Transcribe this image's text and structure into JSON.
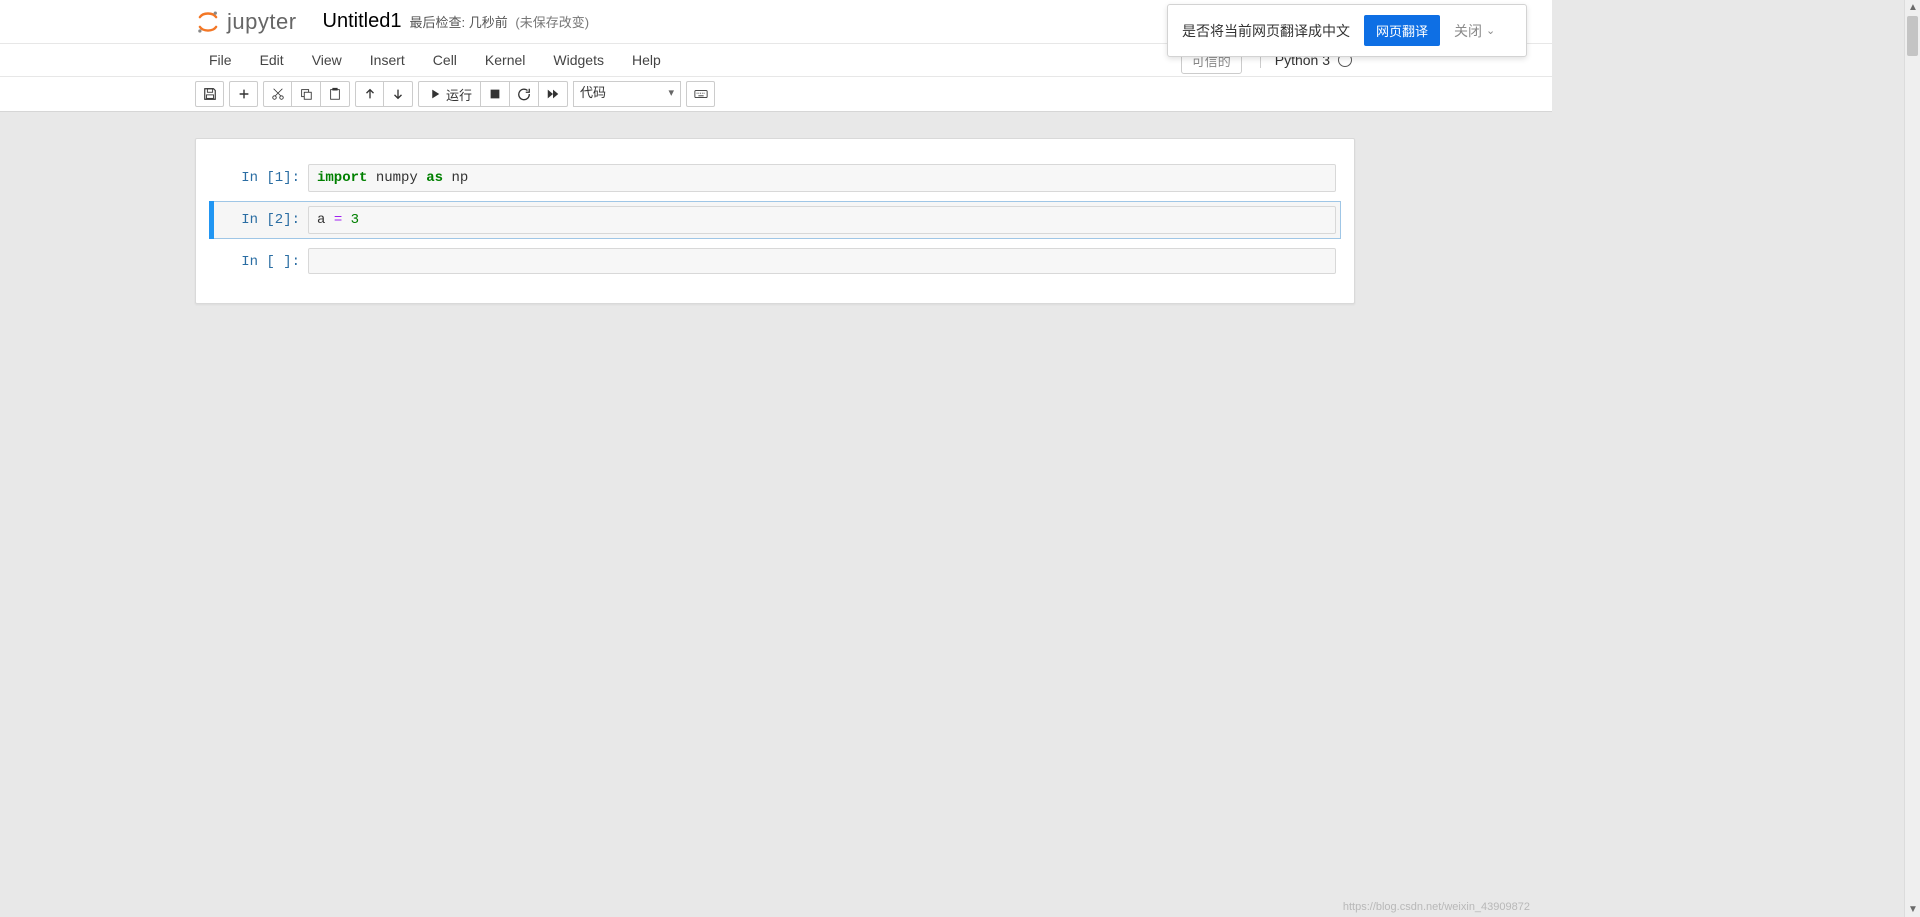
{
  "logo_text": "jupyter",
  "notebook_title": "Untitled1",
  "checkpoint_prefix": "最后检查:",
  "checkpoint_time": "几秒前",
  "unsaved_label": "(未保存改变)",
  "menu": {
    "items": [
      "File",
      "Edit",
      "View",
      "Insert",
      "Cell",
      "Kernel",
      "Widgets",
      "Help"
    ],
    "trusted_label": "可信的",
    "kernel_name": "Python 3"
  },
  "toolbar": {
    "save_title": "保存",
    "add_title": "添加单元格",
    "cut_title": "剪切",
    "copy_title": "复制",
    "paste_title": "粘贴",
    "up_title": "上移",
    "down_title": "下移",
    "run_label": "运行",
    "stop_title": "中断",
    "restart_title": "重启内核",
    "ff_title": "重启并运行全部",
    "celltype_value": "代码",
    "cmd_title": "命令面板"
  },
  "cells": [
    {
      "prompt": "In  [1]:",
      "code_html": "<span class=\"tok-kw\">import</span> numpy <span class=\"tok-kw\">as</span> np",
      "selected": false
    },
    {
      "prompt": "In  [2]:",
      "code_html": "a <span class=\"tok-op\">=</span> <span class=\"tok-num\">3</span>",
      "selected": true
    },
    {
      "prompt": "In  [ ]:",
      "code_html": "",
      "selected": false
    }
  ],
  "translate": {
    "question": "是否将当前网页翻译成中文",
    "translate_btn": "网页翻译",
    "close_label": "关闭"
  },
  "watermark": "https://blog.csdn.net/weixin_43909872"
}
